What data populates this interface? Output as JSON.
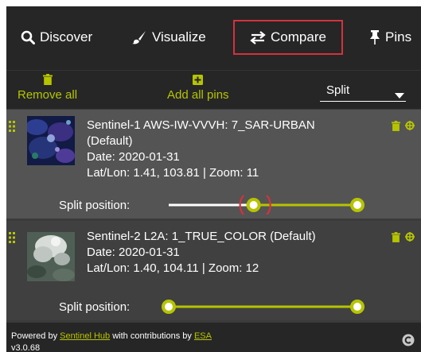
{
  "tabs": {
    "discover": "Discover",
    "visualize": "Visualize",
    "compare": "Compare",
    "pins": "Pins"
  },
  "toolbar": {
    "remove_all": "Remove all",
    "add_all_pins": "Add all pins",
    "mode": "Split"
  },
  "pins": [
    {
      "title": "Sentinel-1 AWS-IW-VVVH: 7_SAR-URBAN",
      "subtitle": "(Default)",
      "date": "Date: 2020-01-31",
      "location": "Lat/Lon: 1.41, 103.81 | Zoom: 11",
      "split_label": "Split position:",
      "split_range": [
        0.45,
        1.0
      ]
    },
    {
      "title": "Sentinel-2 L2A: 1_TRUE_COLOR (Default)",
      "date": "Date: 2020-01-31",
      "location": "Lat/Lon: 1.40, 104.11 | Zoom: 12",
      "split_label": "Split position:",
      "split_range": [
        0.0,
        1.0
      ]
    }
  ],
  "footer": {
    "powered_by": "Powered by",
    "sentinel_hub": "Sentinel Hub",
    "contributions": "with contributions by",
    "esa": "ESA",
    "version": "v3.0.68"
  },
  "colors": {
    "accent": "#b6c400",
    "highlight": "#d4323c",
    "tab_bar": "#262626",
    "card_active": "#545454",
    "card": "#404040"
  },
  "icons": {
    "discover": "search-icon",
    "visualize": "brush-icon",
    "compare": "swap-arrows-icon",
    "pins": "pin-icon",
    "remove": "trash-icon",
    "add": "plus-square-icon",
    "drag": "drag-handle-icon",
    "zoom_to": "target-icon",
    "version_logo": "copyright-icon"
  }
}
